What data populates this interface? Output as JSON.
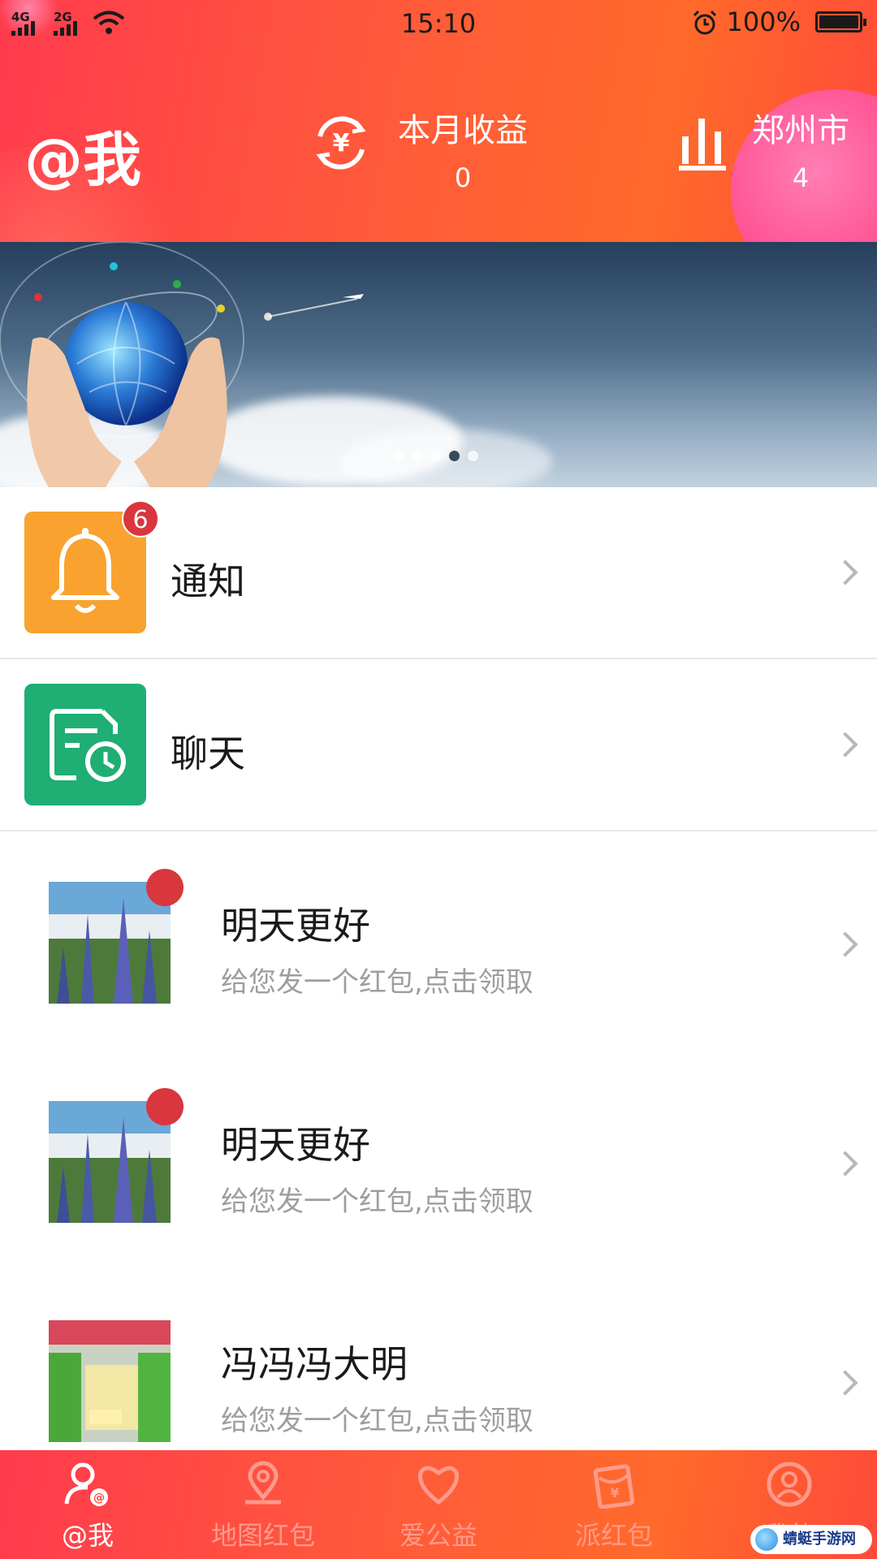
{
  "status_bar": {
    "signal_1": "4G",
    "signal_2": "2G",
    "time": "15:10",
    "battery": "100%"
  },
  "header": {
    "title": "@我",
    "earnings": {
      "label": "本月收益",
      "value": "0"
    },
    "city": {
      "label": "郑州市",
      "value": "4"
    }
  },
  "banner": {
    "page_count": 5,
    "active_index": 3
  },
  "menu": [
    {
      "label": "通知",
      "badge": "6",
      "icon": "bell-icon",
      "color": "#f9a22f"
    },
    {
      "label": "聊天",
      "icon": "chat-history-icon",
      "color": "#1fae74"
    }
  ],
  "messages": [
    {
      "name": "明天更好",
      "text": "给您发一个红包,点击领取",
      "unread": true
    },
    {
      "name": "明天更好",
      "text": "给您发一个红包,点击领取",
      "unread": true
    },
    {
      "name": "冯冯冯大明",
      "text": "给您发一个红包,点击领取",
      "unread": false
    }
  ],
  "tabs": [
    {
      "label": "@我",
      "icon": "user-at-icon",
      "active": true
    },
    {
      "label": "地图红包",
      "icon": "map-pin-icon",
      "active": false
    },
    {
      "label": "爱公益",
      "icon": "heart-icon",
      "active": false
    },
    {
      "label": "派红包",
      "icon": "red-packet-icon",
      "active": false
    },
    {
      "label": "我的",
      "icon": "profile-icon",
      "active": false
    }
  ],
  "watermark": "蜻蜓手游网",
  "colors": {
    "accent": "#ff5a3a",
    "badge": "#d9363e"
  }
}
